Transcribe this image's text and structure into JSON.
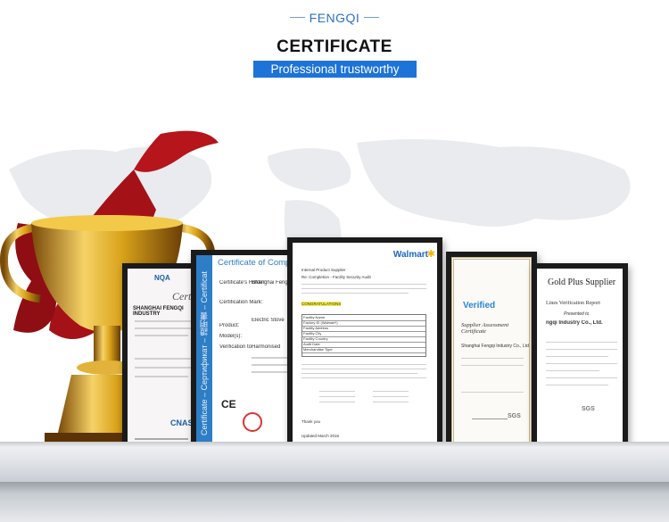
{
  "header": {
    "brand": "FENGQI",
    "title": "CERTIFICATE",
    "subtitle": "Professional trustworthy"
  },
  "colors": {
    "accent": "#1d73d8",
    "brand_text": "#2c6fc4",
    "trophy_gold": "#d9a21a",
    "ribbon_red": "#b5151b"
  },
  "certificates": {
    "c1": {
      "badge": "NQA",
      "title": "Certificate",
      "company": "SHANGHAI FENGQI INDUSTRY",
      "logo": "CNAS"
    },
    "c2": {
      "title": "Certificate of Compl",
      "strip": "Certificate – Сертификат – 證明書 – Certificat",
      "field_1": "Certificate's Holder:",
      "field_2": "Certification Mark:",
      "field_3": "Product:",
      "field_4": "Model(s):",
      "field_5": "Verification to:",
      "holder": "Shanghai Feng",
      "product": "Electric Stove",
      "standard": "Harmonised",
      "mark": "CE"
    },
    "c3": {
      "logo": "Walmart",
      "header_1": "Internal Product Supplier",
      "header_2": "Re: Completion - Facility Security Audit",
      "highlight": "CONGRATULATIONS",
      "table_1": "Facility Name",
      "table_2": "Factory ID (Walmart*)",
      "table_3": "Facility Address",
      "table_4": "Facility City",
      "table_5": "Facility Country",
      "table_6": "Audit Date",
      "table_7": "Merchandise Type",
      "footer_1": "Thank you",
      "footer_2": "Updated March 2016"
    },
    "c4": {
      "logo": "Verified",
      "title": "Supplier Assessment Certificate",
      "company": "Shanghai Fengqi Industry Co., Ltd.",
      "seal": "SGS"
    },
    "c5": {
      "title": "Gold Plus Supplier",
      "subtitle": "Lines Verification Report",
      "presented": "Presented to",
      "company": "ngqi Industry Co., Ltd.",
      "seal": "SGS"
    }
  }
}
